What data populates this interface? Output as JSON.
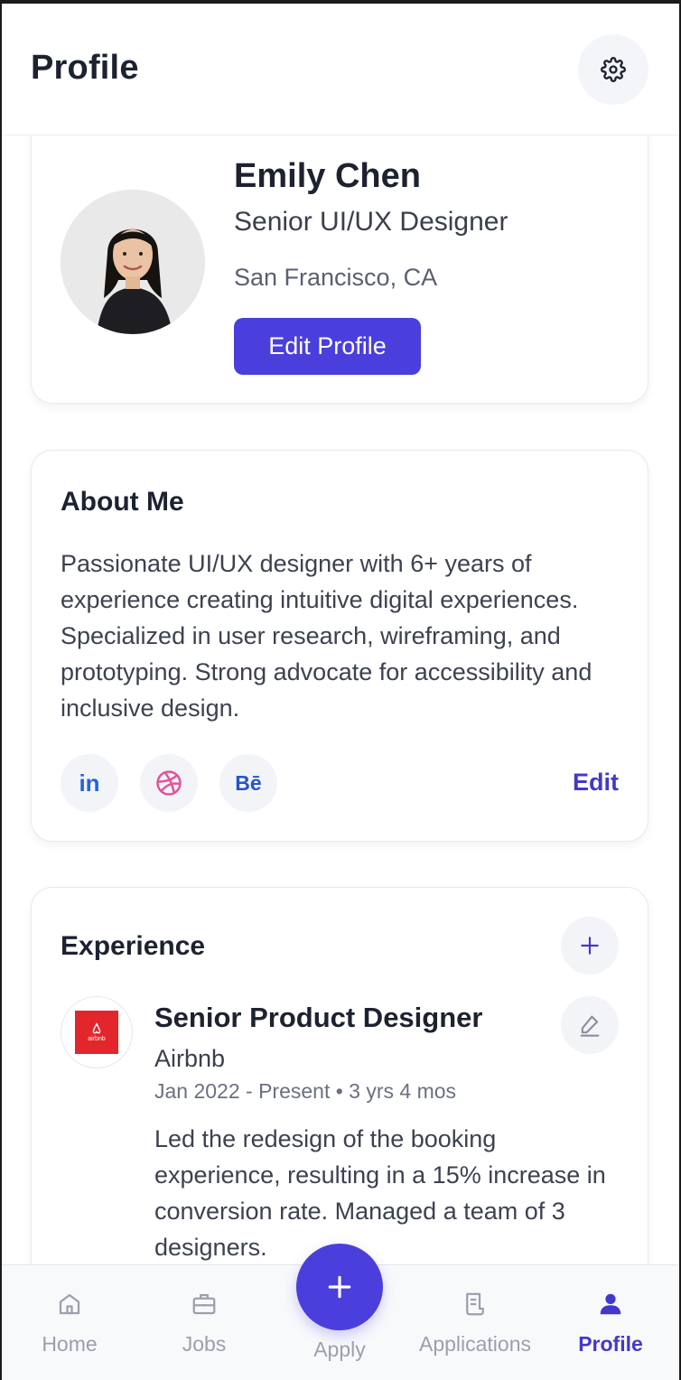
{
  "header": {
    "title": "Profile",
    "settings_icon": "gear-icon"
  },
  "profile": {
    "name": "Emily Chen",
    "title": "Senior UI/UX Designer",
    "location": "San Francisco, CA",
    "edit_button": "Edit Profile"
  },
  "about": {
    "title": "About Me",
    "text": "Passionate UI/UX designer with 6+ years of experience creating intuitive digital experiences. Specialized in user research, wireframing, and prototyping. Strong advocate for accessibility and inclusive design.",
    "social": {
      "linkedin": "in",
      "behance": "Bē"
    },
    "edit_label": "Edit"
  },
  "experience": {
    "title": "Experience",
    "items": [
      {
        "role": "Senior Product Designer",
        "company": "Airbnb",
        "logo_text": "airbnb",
        "dates": "Jan 2022 - Present • 3 yrs 4 mos",
        "description": "Led the redesign of the booking experience, resulting in a 15% increase in conversion rate. Managed a team of 3 designers."
      }
    ]
  },
  "nav": {
    "home": "Home",
    "jobs": "Jobs",
    "apply": "Apply",
    "applications": "Applications",
    "profile": "Profile"
  },
  "colors": {
    "accent": "#4a3fdc",
    "accent_text": "#4338ca",
    "linkedin": "#2563d9",
    "dribbble": "#e0559a",
    "behance": "#2455c8",
    "airbnb": "#e3262c"
  }
}
